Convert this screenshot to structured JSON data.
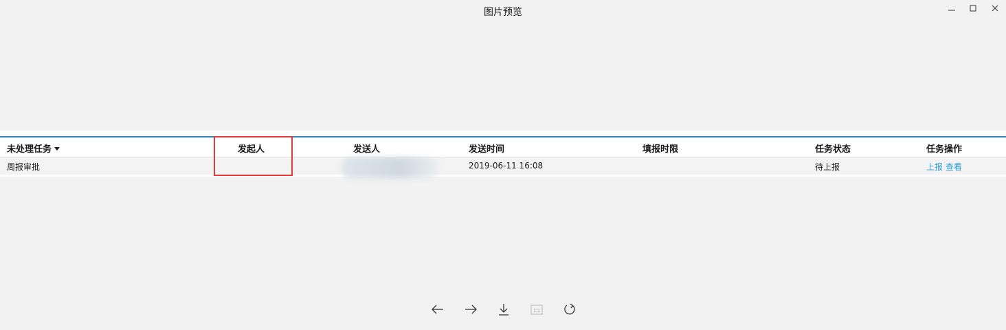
{
  "window": {
    "title": "图片预览",
    "controls": {
      "minimize_icon": "minimize-icon",
      "maximize_icon": "maximize-icon",
      "close_icon": "close-icon"
    }
  },
  "table": {
    "headers": [
      "未处理任务",
      "发起人",
      "发送人",
      "发送时间",
      "填报时限",
      "任务状态",
      "任务操作"
    ],
    "sort_icon": "caret-down-icon",
    "row": {
      "task": "周报审批",
      "initiator": "",
      "sender": "",
      "send_time": "2019-06-11 16:08",
      "deadline": "",
      "status": "待上报",
      "actions": [
        "上报",
        "查看"
      ]
    }
  },
  "annotation": {
    "highlight_color": "#e33b3b"
  },
  "colors": {
    "accent": "#2b86c5",
    "link": "#2b9ad6",
    "background": "#f2f2f2"
  },
  "toolbar": {
    "icons": [
      "arrow-left-icon",
      "arrow-right-icon",
      "download-icon",
      "original-size-icon",
      "rotate-icon"
    ],
    "ratio_label": "1:1"
  }
}
